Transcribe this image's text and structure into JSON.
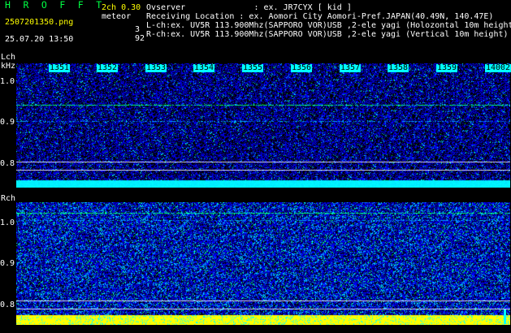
{
  "header": {
    "app_title": "H R O F F T",
    "version": "2ch 0.30",
    "file_name": "2507201350.png",
    "datetime": "25.07.20 13:50",
    "meteor_label": "meteor",
    "meteor_count_l": "3",
    "meteor_count_r": "92"
  },
  "info": {
    "observer": "Ovserver              : ex. JR7CYX [ kid ]",
    "location": "Receiving Location : ex. Aomori City Aomori-Pref.JAPAN(40.49N, 140.47E)",
    "lch": "L-ch:ex. UV5R 113.900Mhz(SAPPORO VOR)USB ,2-ele yagi (Holozontal 10m height)",
    "rch": "R-ch:ex. UV5R 113.900Mhz(SAPPORO VOR)USB ,2-ele yagi (Vertical 10m height)"
  },
  "lch": {
    "label": "Lch",
    "unit": "kHz",
    "ticks": [
      "1.0",
      "0.9",
      "0.8"
    ]
  },
  "rch": {
    "label": "Rch",
    "ticks": [
      "1.0",
      "0.9",
      "0.8"
    ]
  },
  "time_marks": [
    "1351",
    "1352",
    "1353",
    "1354",
    "1355",
    "1356",
    "1357",
    "1358",
    "1359",
    "1400",
    "2"
  ],
  "colors": {
    "background": "#000000",
    "waterfall_low": "#000080",
    "waterfall_mid": "#0000ff",
    "waterfall_high": "#00ffff",
    "signal_green": "#00ff44",
    "marker_cyan": "#00ffff",
    "band_yellow": "#ffff00"
  }
}
